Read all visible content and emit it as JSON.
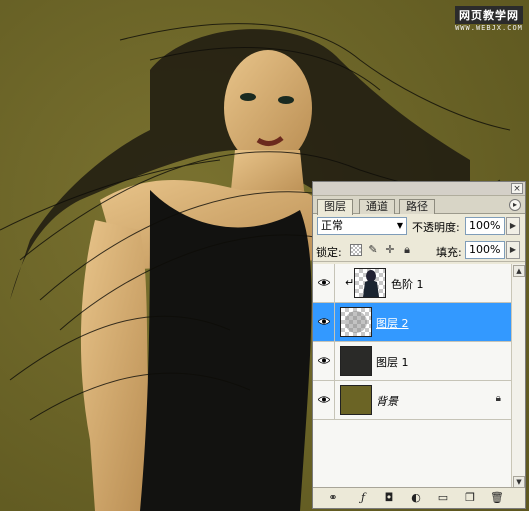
{
  "watermark": {
    "title": "网页教学网",
    "url": "WWW.WEBJX.COM"
  },
  "colors": {
    "background": "#6b6425",
    "selection": "#3399ff",
    "panel": "#ece9d8"
  },
  "panel": {
    "close_icon": "×",
    "tabs": [
      {
        "label": "图层",
        "active": true
      },
      {
        "label": "通道",
        "active": false
      },
      {
        "label": "路径",
        "active": false
      }
    ],
    "menu_icon": "▸",
    "blend_mode": "正常",
    "opacity_label": "不透明度:",
    "opacity_value": "100%",
    "lock_label": "锁定:",
    "fill_label": "填充:",
    "fill_value": "100%",
    "layers": [
      {
        "name": "色阶 1",
        "visible": true,
        "selected": false,
        "clipped": true,
        "thumbnail": "adjustment-levels"
      },
      {
        "name": "图层 2",
        "visible": true,
        "selected": true,
        "clipped": false,
        "thumbnail": "transparent"
      },
      {
        "name": "图层 1",
        "visible": true,
        "selected": false,
        "clipped": false,
        "thumbnail": "dark-fill"
      },
      {
        "name": "背景",
        "visible": true,
        "selected": false,
        "clipped": false,
        "locked": true,
        "thumbnail": "olive-fill"
      }
    ],
    "footer_icons": [
      "link-icon",
      "layer-style-icon",
      "mask-icon",
      "adjustment-icon",
      "group-icon",
      "new-layer-icon",
      "trash-icon"
    ]
  }
}
